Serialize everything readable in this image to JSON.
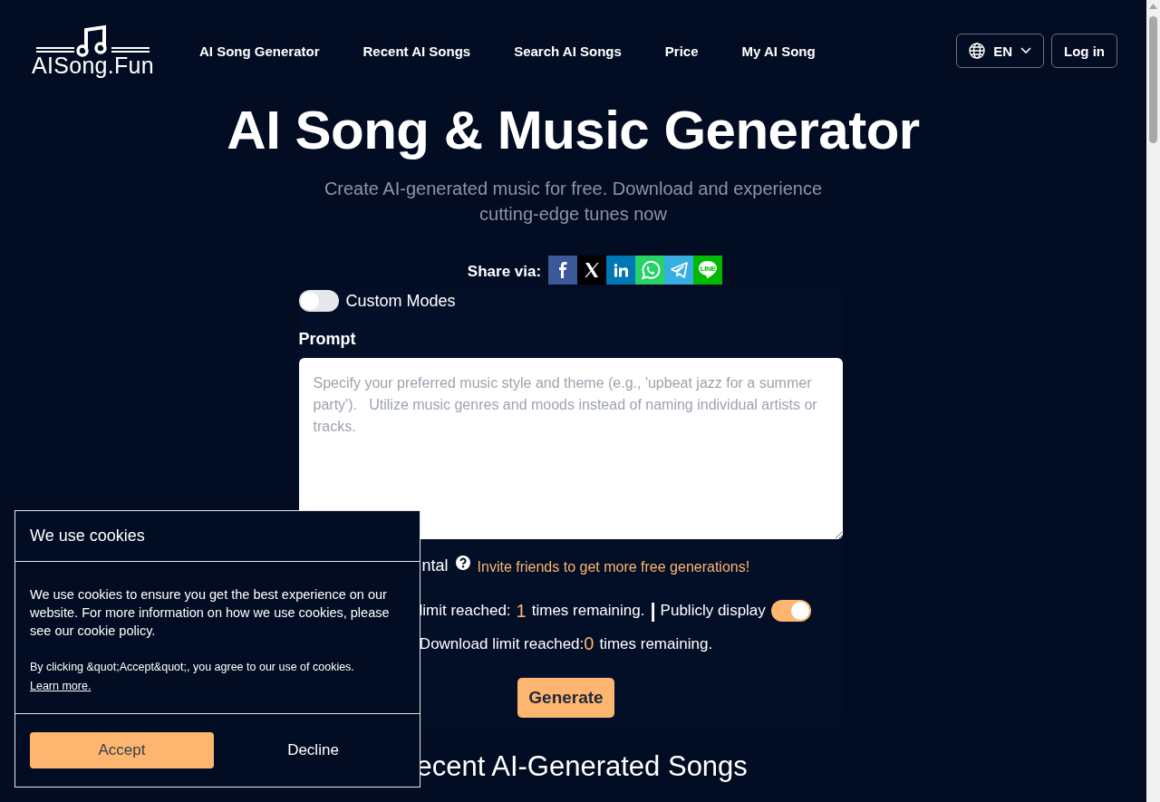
{
  "logo": {
    "text": "AISong.Fun"
  },
  "nav": [
    {
      "label": "AI Song Generator"
    },
    {
      "label": "Recent AI Songs"
    },
    {
      "label": "Search AI Songs"
    },
    {
      "label": "Price"
    },
    {
      "label": "My AI Song"
    }
  ],
  "language": {
    "label": "EN"
  },
  "login": {
    "label": "Log in"
  },
  "hero": {
    "title": "AI Song & Music Generator",
    "subtitle": "Create AI-generated music for free. Download and experience cutting-edge tunes now"
  },
  "share": {
    "label": "Share via:",
    "buttons": [
      {
        "kind": "facebook",
        "color": "#3b5998"
      },
      {
        "kind": "x",
        "color": "#000000"
      },
      {
        "kind": "linkedin",
        "color": "#0077b5"
      },
      {
        "kind": "whatsapp",
        "color": "#25d366"
      },
      {
        "kind": "telegram",
        "color": "#37aee2"
      },
      {
        "kind": "line",
        "color": "#00b900",
        "text": "LINE"
      }
    ]
  },
  "form": {
    "custom_modes": {
      "label": "Custom Modes",
      "on": false
    },
    "prompt": {
      "label": "Prompt",
      "placeholder": "Specify your preferred music style and theme (e.g., 'upbeat jazz for a summer party').   Utilize music genres and moods instead of naming individual artists or tracks."
    },
    "instrumental": {
      "label": "ntal"
    },
    "invite": "Invite friends to get more free generations!",
    "generation": {
      "text": "limit reached:",
      "count": "1",
      "suffix": "times remaining.",
      "separator": "|"
    },
    "public_display": {
      "label": "Publicly display",
      "on": true
    },
    "download": {
      "text": "Download limit reached:",
      "count": "0",
      "suffix": "times remaining."
    },
    "generate": {
      "label": "Generate"
    }
  },
  "recent_heading": "ecent AI-Generated Songs",
  "cookie": {
    "title": "We use cookies",
    "body": "We use cookies to ensure you get the best experience on our website. For more information on how we use cookies, please see our cookie policy.",
    "consent": "By clicking &quot;Accept&quot;, you agree to our use of cookies.",
    "link": "Learn more.",
    "accept": "Accept",
    "decline": "Decline"
  }
}
